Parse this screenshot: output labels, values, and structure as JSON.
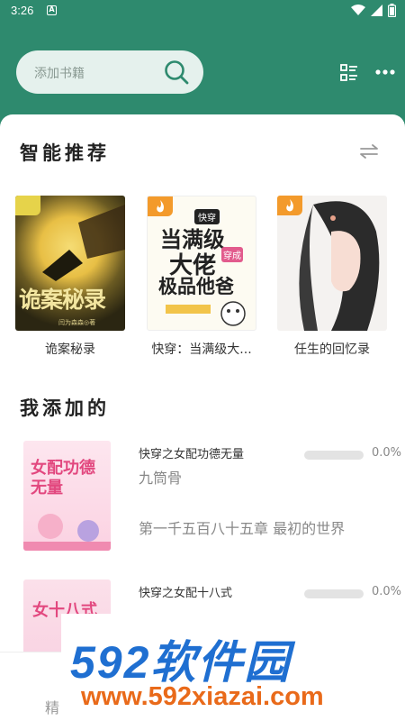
{
  "status_bar": {
    "time": "3:26",
    "notification_glyph": "A"
  },
  "search": {
    "placeholder": "添加书籍"
  },
  "recommend": {
    "title": "智能推荐",
    "books": [
      {
        "title": "诡案秘录",
        "cover_text": "诡案秘录",
        "cover_author": "闫为森森◎著"
      },
      {
        "title": "快穿：当满级大...",
        "cover_text_1": "当满级",
        "cover_text_2": "大佬",
        "cover_text_3": "极品他爸",
        "cover_tag": "快穿",
        "cover_badge": "穿成"
      },
      {
        "title": "任生的回忆录"
      }
    ]
  },
  "my_books": {
    "title": "我添加的",
    "items": [
      {
        "name": "快穿之女配功德无量",
        "author": "九筒骨",
        "chapter": "第一千五百八十五章 最初的世界",
        "progress": "0.0%",
        "progress_value": 0.0,
        "cover_text": "女配功德无量"
      },
      {
        "name": "快穿之女配十八式",
        "author": "…",
        "progress": "0.0%",
        "progress_value": 0.0,
        "cover_text": "女十八式"
      }
    ]
  },
  "bottom_tab": {
    "label": "精"
  },
  "watermark": {
    "brand": "592软件园",
    "url": "www.592xiazai.com"
  }
}
